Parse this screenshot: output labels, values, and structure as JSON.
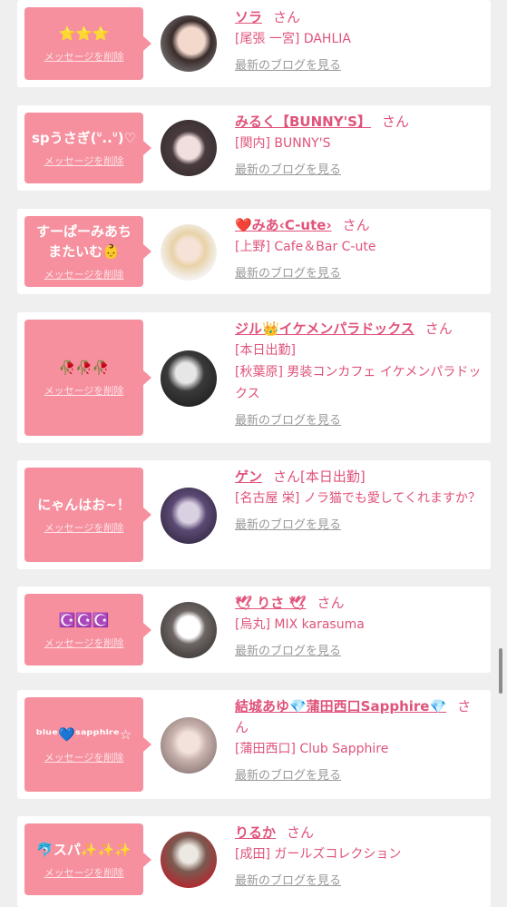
{
  "cards": [
    {
      "bubble": "⭐⭐⭐",
      "delete": "メッセージを削除",
      "name": "ソラ",
      "san": "さん",
      "shop": "[尾張 一宮] DAHLIA",
      "blog": "最新のブログを見る"
    },
    {
      "bubble": "spうさぎ(ᐡ..ᐡ)♡",
      "delete": "メッセージを削除",
      "name": "みるく【BUNNY'S】",
      "san": "さん",
      "shop": "[関内] BUNNY'S",
      "blog": "最新のブログを見る"
    },
    {
      "bubble": "すーぱーみあちまたいむ👶",
      "delete": "メッセージを削除",
      "name": "❤️みあ‹C-ute›",
      "san": "さん",
      "shop": "[上野] Cafe＆Bar C-ute",
      "blog": "最新のブログを見る"
    },
    {
      "bubble": "🥀🥀🥀",
      "delete": "メッセージを削除",
      "name": "ジル👑イケメンパラドックス",
      "san": "さん",
      "status": "[本日出勤]",
      "shop": "[秋葉原] 男装コンカフェ イケメンパラドックス",
      "blog": "最新のブログを見る"
    },
    {
      "bubble": "にゃんはお~！",
      "delete": "メッセージを削除",
      "name": "ゲン",
      "san": "さん[本日出勤]",
      "shop": "[名古屋 栄] ノラ猫でも愛してくれますか？",
      "blog": "最新のブログを見る"
    },
    {
      "bubble": "☪️☪️☪️",
      "delete": "メッセージを削除",
      "name": "🕊 りさ 🕊",
      "san": "さん",
      "shop": "[烏丸] MIX karasuma",
      "blog": "最新のブログを見る"
    },
    {
      "bubble": "ᵇˡᵘᵉ💙ˢᵃᵖᵖʰⁱʳᵉ☆",
      "delete": "メッセージを削除",
      "name": "結城あゆ💎蒲田西口Sapphire💎",
      "san": "さん",
      "shop": "[蒲田西口] Club Sapphire",
      "blog": "最新のブログを見る"
    },
    {
      "bubble": "🐬スパ✨✨✨",
      "delete": "メッセージを削除",
      "name": "りるか",
      "san": "さん",
      "shop": "[成田] ガールズコレクション",
      "blog": "最新のブログを見る"
    }
  ],
  "colors": {
    "bubble": "#f6909e",
    "name": "#e0537a",
    "background": "#efefef"
  },
  "icons": {
    "avatar": "user-photo-icon"
  }
}
